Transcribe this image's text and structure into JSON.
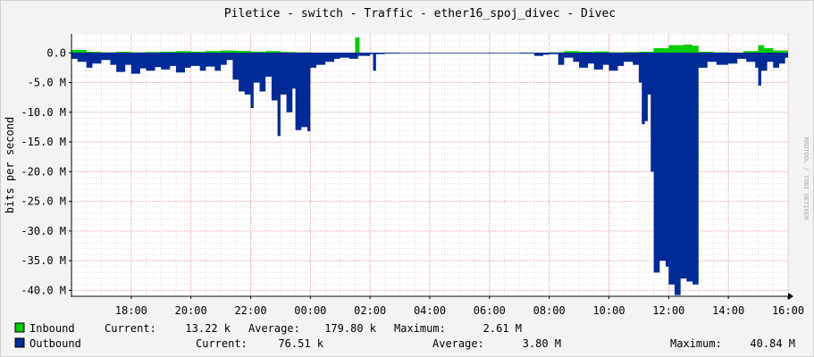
{
  "chart_data": {
    "type": "area",
    "title": "Piletice - switch - Traffic - ether16_spoj_divec - Divec",
    "ylabel": "bits per second",
    "watermark": "RRDTOOL / TOBI OETIKER",
    "x_tick_labels": [
      "18:00",
      "20:00",
      "22:00",
      "00:00",
      "02:00",
      "04:00",
      "06:00",
      "08:00",
      "10:00",
      "12:00",
      "14:00",
      "16:00"
    ],
    "y_tick_labels": [
      "0.0",
      "-5.0 M",
      "-10.0 M",
      "-15.0 M",
      "-20.0 M",
      "-25.0 M",
      "-30.0 M",
      "-35.0 M",
      "-40.0 M"
    ],
    "y_ticks": [
      0,
      -5,
      -10,
      -15,
      -20,
      -25,
      -30,
      -35,
      -40
    ],
    "ylim": [
      -41,
      3.2
    ],
    "xlim_hours": [
      16,
      40
    ],
    "y_unit": "M bits per second",
    "x_unit": "hours (16 = 16:00, 40 = 16:00 next day)",
    "grid": true,
    "series": [
      {
        "name": "Inbound",
        "color": "#00cc00",
        "legend": {
          "label": "Inbound",
          "current": "13.22 k",
          "average": "179.80 k",
          "maximum": "2.61 M"
        },
        "points": [
          [
            16.0,
            0.5
          ],
          [
            16.5,
            0.2
          ],
          [
            17.0,
            0.1
          ],
          [
            17.5,
            0.2
          ],
          [
            18.0,
            0.1
          ],
          [
            18.5,
            0.15
          ],
          [
            19.0,
            0.2
          ],
          [
            19.5,
            0.3
          ],
          [
            20.0,
            0.2
          ],
          [
            20.5,
            0.3
          ],
          [
            21.0,
            0.4
          ],
          [
            21.5,
            0.35
          ],
          [
            22.0,
            0.2
          ],
          [
            22.5,
            0.3
          ],
          [
            23.0,
            0.15
          ],
          [
            23.5,
            0.1
          ],
          [
            24.0,
            0.05
          ],
          [
            24.5,
            0.05
          ],
          [
            25.0,
            0.05
          ],
          [
            25.45,
            0.0
          ],
          [
            25.5,
            2.6
          ],
          [
            25.6,
            2.6
          ],
          [
            25.65,
            0.0
          ],
          [
            26.0,
            0.05
          ],
          [
            27.0,
            0.02
          ],
          [
            28.0,
            0.02
          ],
          [
            29.0,
            0.02
          ],
          [
            30.0,
            0.03
          ],
          [
            31.0,
            0.05
          ],
          [
            32.0,
            0.1
          ],
          [
            32.5,
            0.3
          ],
          [
            33.0,
            0.2
          ],
          [
            33.5,
            0.25
          ],
          [
            34.0,
            0.1
          ],
          [
            34.5,
            0.15
          ],
          [
            35.0,
            0.2
          ],
          [
            35.5,
            0.8
          ],
          [
            36.0,
            1.3
          ],
          [
            36.5,
            1.4
          ],
          [
            36.8,
            1.2
          ],
          [
            37.0,
            0.2
          ],
          [
            37.5,
            0.1
          ],
          [
            38.0,
            0.05
          ],
          [
            38.5,
            0.3
          ],
          [
            39.0,
            1.3
          ],
          [
            39.2,
            0.8
          ],
          [
            39.5,
            0.4
          ],
          [
            40.0,
            0.05
          ]
        ]
      },
      {
        "name": "Outbound",
        "color": "#002a97",
        "legend": {
          "label": "Outbound",
          "current": "76.51 k",
          "average": "3.80 M",
          "maximum": "40.84 M"
        },
        "points": [
          [
            16.0,
            -1.0
          ],
          [
            16.2,
            -1.5
          ],
          [
            16.5,
            -2.5
          ],
          [
            16.7,
            -1.8
          ],
          [
            17.0,
            -1.2
          ],
          [
            17.3,
            -2.0
          ],
          [
            17.5,
            -3.2
          ],
          [
            17.8,
            -2.0
          ],
          [
            18.0,
            -3.5
          ],
          [
            18.3,
            -2.6
          ],
          [
            18.5,
            -3.0
          ],
          [
            18.8,
            -2.4
          ],
          [
            19.0,
            -2.8
          ],
          [
            19.3,
            -2.2
          ],
          [
            19.5,
            -3.3
          ],
          [
            19.8,
            -2.5
          ],
          [
            20.0,
            -2.2
          ],
          [
            20.3,
            -3.0
          ],
          [
            20.5,
            -2.3
          ],
          [
            20.8,
            -3.0
          ],
          [
            21.0,
            -2.0
          ],
          [
            21.2,
            -1.2
          ],
          [
            21.4,
            -4.5
          ],
          [
            21.6,
            -6.5
          ],
          [
            21.8,
            -7.0
          ],
          [
            22.0,
            -9.3
          ],
          [
            22.1,
            -5.0
          ],
          [
            22.3,
            -6.5
          ],
          [
            22.5,
            -4.0
          ],
          [
            22.7,
            -8.0
          ],
          [
            22.9,
            -14.0
          ],
          [
            23.0,
            -7.0
          ],
          [
            23.2,
            -10.0
          ],
          [
            23.4,
            -6.0
          ],
          [
            23.5,
            -13.0
          ],
          [
            23.7,
            -12.5
          ],
          [
            23.9,
            -13.2
          ],
          [
            24.0,
            -2.5
          ],
          [
            24.2,
            -2.0
          ],
          [
            24.5,
            -1.5
          ],
          [
            24.8,
            -1.0
          ],
          [
            25.0,
            -0.8
          ],
          [
            25.3,
            -1.0
          ],
          [
            25.6,
            -0.5
          ],
          [
            26.0,
            -0.2
          ],
          [
            26.1,
            -3.0
          ],
          [
            26.2,
            -0.2
          ],
          [
            26.5,
            -0.1
          ],
          [
            27.0,
            -0.05
          ],
          [
            28.0,
            -0.05
          ],
          [
            29.0,
            -0.05
          ],
          [
            30.0,
            -0.05
          ],
          [
            31.0,
            -0.1
          ],
          [
            31.5,
            -0.5
          ],
          [
            31.8,
            -0.3
          ],
          [
            32.0,
            -0.2
          ],
          [
            32.3,
            -2.0
          ],
          [
            32.5,
            -0.8
          ],
          [
            32.8,
            -1.5
          ],
          [
            33.0,
            -2.5
          ],
          [
            33.3,
            -1.8
          ],
          [
            33.5,
            -2.8
          ],
          [
            33.8,
            -2.0
          ],
          [
            34.0,
            -3.0
          ],
          [
            34.3,
            -2.2
          ],
          [
            34.5,
            -1.5
          ],
          [
            34.8,
            -2.0
          ],
          [
            35.0,
            -5.0
          ],
          [
            35.1,
            -12.0
          ],
          [
            35.2,
            -11.5
          ],
          [
            35.3,
            -7.0
          ],
          [
            35.4,
            -20.0
          ],
          [
            35.5,
            -37.0
          ],
          [
            35.7,
            -35.0
          ],
          [
            35.9,
            -36.0
          ],
          [
            36.0,
            -39.0
          ],
          [
            36.2,
            -40.8
          ],
          [
            36.4,
            -38.0
          ],
          [
            36.6,
            -38.5
          ],
          [
            36.8,
            -39.0
          ],
          [
            37.0,
            -2.5
          ],
          [
            37.3,
            -1.5
          ],
          [
            37.6,
            -2.0
          ],
          [
            38.0,
            -1.8
          ],
          [
            38.3,
            -1.0
          ],
          [
            38.6,
            -1.5
          ],
          [
            38.9,
            -2.5
          ],
          [
            39.0,
            -5.5
          ],
          [
            39.1,
            -3.0
          ],
          [
            39.3,
            -1.5
          ],
          [
            39.5,
            -2.5
          ],
          [
            39.7,
            -1.8
          ],
          [
            39.9,
            -0.8
          ],
          [
            40.0,
            -0.1
          ]
        ]
      }
    ],
    "legend_header": {
      "current": "Current:",
      "average": "Average:",
      "maximum": "Maximum:"
    }
  }
}
